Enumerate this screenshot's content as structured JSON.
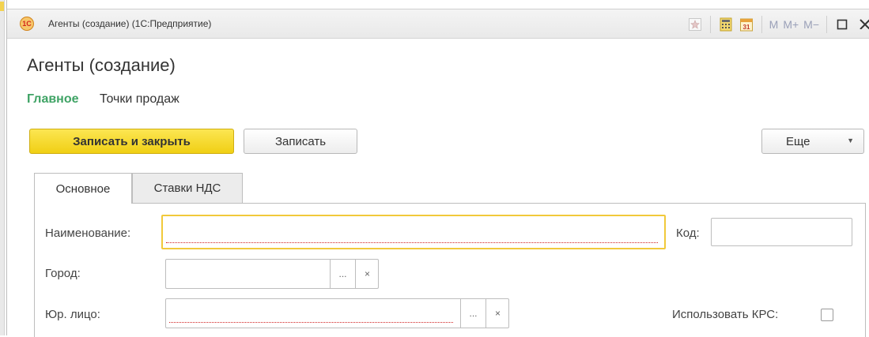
{
  "window": {
    "title": "Агенты (создание)  (1С:Предприятие)",
    "app_icon_text": "1С",
    "toolbar": {
      "m_label": "M",
      "m_plus_label": "M+",
      "m_minus_label": "M−",
      "calendar_day": "31"
    }
  },
  "form": {
    "title": "Агенты (создание)",
    "nav": {
      "main": "Главное",
      "points_of_sale": "Точки продаж"
    },
    "commands": {
      "save_close": "Записать и закрыть",
      "save": "Записать",
      "more": "Еще"
    },
    "tabs": [
      {
        "label": "Основное",
        "active": true
      },
      {
        "label": "Ставки НДС",
        "active": false
      }
    ],
    "fields": {
      "name": {
        "label": "Наименование:",
        "value": ""
      },
      "code": {
        "label": "Код:",
        "value": ""
      },
      "city": {
        "label": "Город:",
        "value": ""
      },
      "legal_entity": {
        "label": "Юр. лицо:",
        "value": ""
      },
      "use_krs": {
        "label": "Использовать КРС:",
        "checked": false
      }
    },
    "select_button_text": "...",
    "clear_button_text": "×"
  },
  "colors": {
    "accent_green": "#3fa365",
    "primary_button": "#f0cf14",
    "focus_border": "#f1c93b",
    "required_underline": "#d02020"
  }
}
